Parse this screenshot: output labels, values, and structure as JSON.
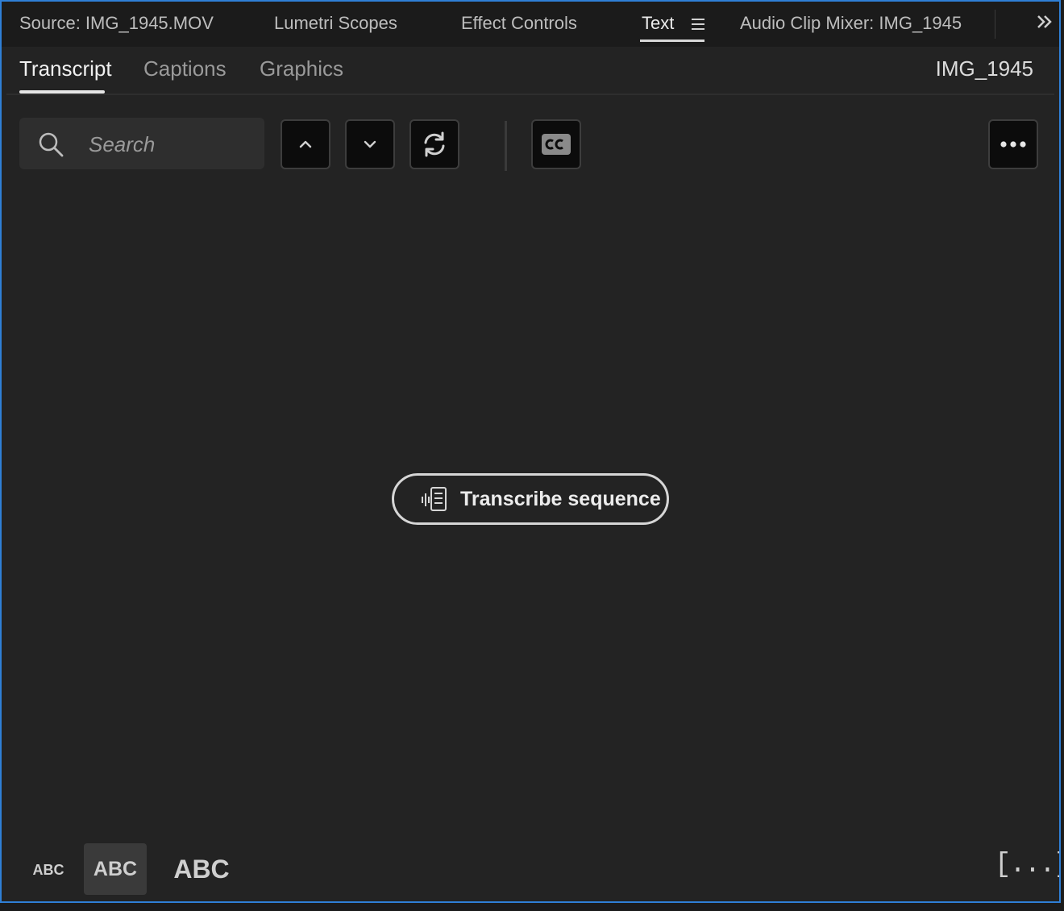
{
  "panel_tabs": [
    {
      "label": "Source: IMG_1945.MOV",
      "active": false
    },
    {
      "label": "Lumetri Scopes",
      "active": false
    },
    {
      "label": "Effect Controls",
      "active": false
    },
    {
      "label": "Text",
      "active": true
    },
    {
      "label": "Audio Clip Mixer: IMG_1945",
      "active": false
    }
  ],
  "sub_tabs": [
    {
      "label": "Transcript",
      "active": true
    },
    {
      "label": "Captions",
      "active": false
    },
    {
      "label": "Graphics",
      "active": false
    }
  ],
  "clip_name": "IMG_1945",
  "search": {
    "placeholder": "Search",
    "value": ""
  },
  "toolbar": {
    "buttons": [
      "chevron-up-icon",
      "chevron-down-icon",
      "refresh-icon",
      "closed-captions-icon",
      "more-options-icon"
    ]
  },
  "transcribe_button": {
    "label": "Transcribe sequence"
  },
  "bottom_bar": {
    "font_size_small": "ABC",
    "font_size_medium": "ABC",
    "font_size_large": "ABC",
    "pause_marker": "[...]",
    "selected_font_size": "medium"
  },
  "colors": {
    "panel_bg": "#232323",
    "focus_border": "#2f7fd6",
    "button_bg": "#0c0c0c"
  }
}
